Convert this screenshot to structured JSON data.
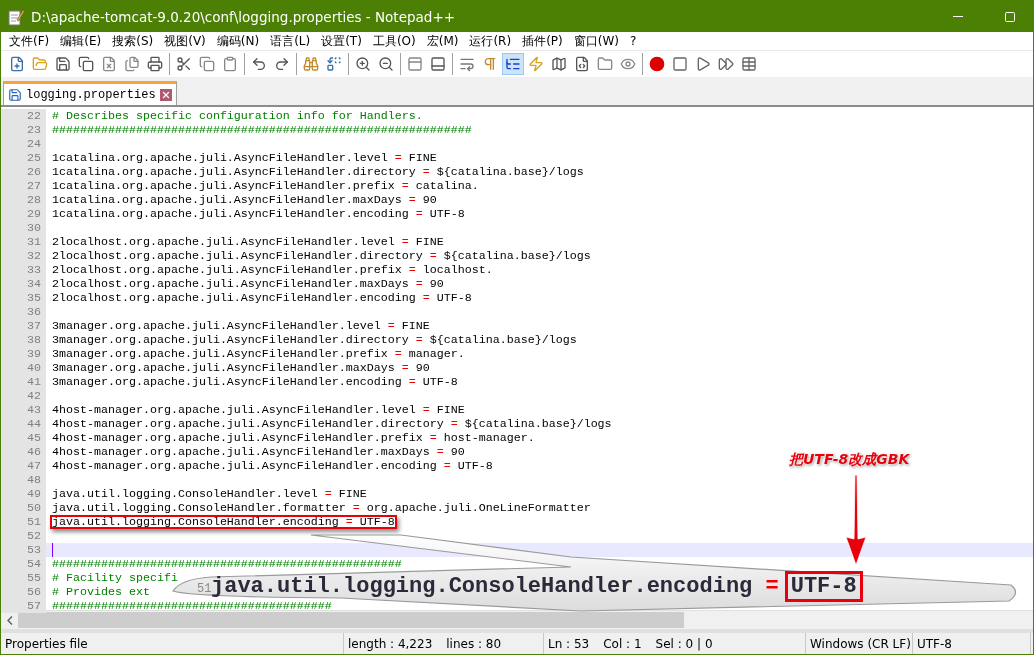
{
  "window": {
    "title": "D:\\apache-tomcat-9.0.20\\conf\\logging.properties - Notepad++"
  },
  "menu": [
    "文件(F)",
    "编辑(E)",
    "搜索(S)",
    "视图(V)",
    "编码(N)",
    "语言(L)",
    "设置(T)",
    "工具(O)",
    "宏(M)",
    "运行(R)",
    "插件(P)",
    "窗口(W)",
    "?"
  ],
  "toolbar": [
    [
      {
        "pressed": false
      },
      {
        "pressed": false
      },
      {
        "pressed": false
      },
      {
        "pressed": false
      },
      {
        "pressed": false
      },
      {
        "pressed": false
      },
      {
        "pressed": false
      }
    ],
    [
      {
        "pressed": false
      },
      {
        "pressed": false
      },
      {
        "pressed": false
      }
    ],
    [
      {
        "pressed": false
      },
      {
        "pressed": false
      }
    ],
    [
      {
        "pressed": false
      },
      {
        "pressed": false
      }
    ],
    [
      {
        "pressed": false
      },
      {
        "pressed": false
      }
    ],
    [
      {
        "pressed": false
      },
      {
        "pressed": false
      }
    ],
    [
      {
        "pressed": false
      },
      {
        "pressed": false
      },
      {
        "pressed": true
      },
      {
        "pressed": false
      },
      {
        "pressed": false
      },
      {
        "pressed": false
      },
      {
        "pressed": false
      },
      {
        "pressed": false
      }
    ],
    [
      {
        "pressed": false
      },
      {
        "pressed": false
      },
      {
        "pressed": false
      },
      {
        "pressed": false
      },
      {
        "pressed": false
      }
    ]
  ],
  "tabs": [
    {
      "label": "logging.properties",
      "selected": true
    }
  ],
  "lines": [
    {
      "n": "22",
      "kind": "comment",
      "text": "# Describes specific configuration info for Handlers."
    },
    {
      "n": "23",
      "kind": "comment",
      "text": "############################################################"
    },
    {
      "n": "24",
      "kind": "blank"
    },
    {
      "n": "25",
      "kind": "prop",
      "key": "1catalina.org.apache.juli.AsyncFileHandler.level",
      "op": "=",
      "value": "FINE"
    },
    {
      "n": "26",
      "kind": "prop",
      "key": "1catalina.org.apache.juli.AsyncFileHandler.directory",
      "op": "=",
      "value": "${catalina.base}/logs"
    },
    {
      "n": "27",
      "kind": "prop",
      "key": "1catalina.org.apache.juli.AsyncFileHandler.prefix",
      "op": "=",
      "value": "catalina."
    },
    {
      "n": "28",
      "kind": "prop",
      "key": "1catalina.org.apache.juli.AsyncFileHandler.maxDays",
      "op": "=",
      "value": "90"
    },
    {
      "n": "29",
      "kind": "prop",
      "key": "1catalina.org.apache.juli.AsyncFileHandler.encoding",
      "op": "=",
      "value": "UTF-8"
    },
    {
      "n": "30",
      "kind": "blank"
    },
    {
      "n": "31",
      "kind": "prop",
      "key": "2localhost.org.apache.juli.AsyncFileHandler.level",
      "op": "=",
      "value": "FINE"
    },
    {
      "n": "32",
      "kind": "prop",
      "key": "2localhost.org.apache.juli.AsyncFileHandler.directory",
      "op": "=",
      "value": "${catalina.base}/logs"
    },
    {
      "n": "33",
      "kind": "prop",
      "key": "2localhost.org.apache.juli.AsyncFileHandler.prefix",
      "op": "=",
      "value": "localhost."
    },
    {
      "n": "34",
      "kind": "prop",
      "key": "2localhost.org.apache.juli.AsyncFileHandler.maxDays",
      "op": "=",
      "value": "90"
    },
    {
      "n": "35",
      "kind": "prop",
      "key": "2localhost.org.apache.juli.AsyncFileHandler.encoding",
      "op": "=",
      "value": "UTF-8"
    },
    {
      "n": "36",
      "kind": "blank"
    },
    {
      "n": "37",
      "kind": "prop",
      "key": "3manager.org.apache.juli.AsyncFileHandler.level",
      "op": "=",
      "value": "FINE"
    },
    {
      "n": "38",
      "kind": "prop",
      "key": "3manager.org.apache.juli.AsyncFileHandler.directory",
      "op": "=",
      "value": "${catalina.base}/logs"
    },
    {
      "n": "39",
      "kind": "prop",
      "key": "3manager.org.apache.juli.AsyncFileHandler.prefix",
      "op": "=",
      "value": "manager."
    },
    {
      "n": "40",
      "kind": "prop",
      "key": "3manager.org.apache.juli.AsyncFileHandler.maxDays",
      "op": "=",
      "value": "90"
    },
    {
      "n": "41",
      "kind": "prop",
      "key": "3manager.org.apache.juli.AsyncFileHandler.encoding",
      "op": "=",
      "value": "UTF-8"
    },
    {
      "n": "42",
      "kind": "blank"
    },
    {
      "n": "43",
      "kind": "prop",
      "key": "4host-manager.org.apache.juli.AsyncFileHandler.level",
      "op": "=",
      "value": "FINE"
    },
    {
      "n": "44",
      "kind": "prop",
      "key": "4host-manager.org.apache.juli.AsyncFileHandler.directory",
      "op": "=",
      "value": "${catalina.base}/logs"
    },
    {
      "n": "45",
      "kind": "prop",
      "key": "4host-manager.org.apache.juli.AsyncFileHandler.prefix",
      "op": "=",
      "value": "host-manager."
    },
    {
      "n": "46",
      "kind": "prop",
      "key": "4host-manager.org.apache.juli.AsyncFileHandler.maxDays",
      "op": "=",
      "value": "90"
    },
    {
      "n": "47",
      "kind": "prop",
      "key": "4host-manager.org.apache.juli.AsyncFileHandler.encoding",
      "op": "=",
      "value": "UTF-8"
    },
    {
      "n": "48",
      "kind": "blank"
    },
    {
      "n": "49",
      "kind": "prop",
      "key": "java.util.logging.ConsoleHandler.level",
      "op": "=",
      "value": "FINE"
    },
    {
      "n": "50",
      "kind": "prop",
      "key": "java.util.logging.ConsoleHandler.formatter",
      "op": "=",
      "value": "org.apache.juli.OneLineFormatter"
    },
    {
      "n": "51",
      "kind": "prop",
      "key": "java.util.logging.ConsoleHandler.encoding",
      "op": "=",
      "value": "UTF-8",
      "boxed": true
    },
    {
      "n": "52",
      "kind": "blank"
    },
    {
      "n": "53",
      "kind": "blank",
      "current": true
    },
    {
      "n": "54",
      "kind": "comment",
      "text": "##################################################"
    },
    {
      "n": "55",
      "kind": "comment",
      "text": "# Facility specifi"
    },
    {
      "n": "56",
      "kind": "comment",
      "text": "# Provides ext"
    },
    {
      "n": "57",
      "kind": "comment",
      "text": "########################################"
    }
  ],
  "callout": {
    "line_number": "51",
    "key": "java.util.logging.ConsoleHandler.encoding",
    "op": "=",
    "value": "UTF-8"
  },
  "annotation": {
    "text": "把UTF-8改成GBK"
  },
  "status_bar": {
    "file_type": "Properties file",
    "length": "length : 4,223",
    "lines": "lines : 80",
    "ln": "Ln : 53",
    "col": "Col : 1",
    "sel": "Sel : 0 | 0",
    "eol": "Windows (CR LF)",
    "encoding": "UTF-8"
  }
}
